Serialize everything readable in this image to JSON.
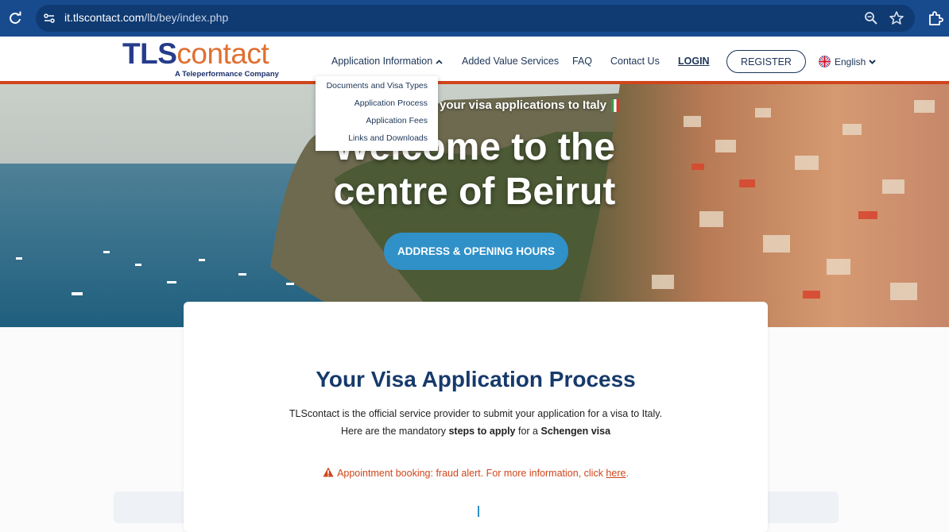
{
  "browser": {
    "url_domain": "it.tlscontact.com",
    "url_path": "/lb/bey/index.php",
    "icons": [
      "reload-icon",
      "site-info-icon",
      "zoom-icon",
      "star-icon",
      "extensions-icon"
    ]
  },
  "header": {
    "logo_tls": "TLS",
    "logo_contact": "contact",
    "logo_sub": "A Teleperformance Company",
    "nav": {
      "app_info": "Application Information",
      "added_value": "Added Value Services",
      "faq": "FAQ",
      "contact": "Contact Us",
      "login": "LOGIN",
      "register": "REGISTER",
      "language": "English"
    }
  },
  "dropdown": {
    "items": [
      "Documents and Visa Types",
      "Application Process",
      "Application Fees",
      "Links and Downloads"
    ]
  },
  "hero": {
    "tagline": "Your partner for all your visa applications to Italy",
    "title_line1": "Welcome to the",
    "title_line2": "centre of Beirut",
    "button": "ADDRESS & OPENING HOURS"
  },
  "main": {
    "title": "Your Visa Application Process",
    "intro": "TLScontact is the official service provider to submit your application for a visa to Italy.",
    "line2_pre": "Here are the mandatory ",
    "line2_bold1": "steps to apply",
    "line2_mid": " for a ",
    "line2_bold2": "Schengen visa",
    "alert_text": "Appointment booking: fraud alert. For more information, click ",
    "alert_link": "here",
    "alert_end": "."
  },
  "colors": {
    "browser_bar": "#184a8e",
    "brand_navy": "#263c8b",
    "brand_orange": "#e06f32",
    "accent_rule": "#d0451b",
    "hero_button": "#2f91c8",
    "title": "#163a6b"
  }
}
